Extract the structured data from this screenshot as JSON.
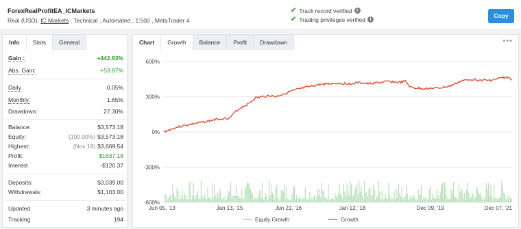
{
  "header": {
    "account_name": "ForexRealProfitEA_ICMarkets",
    "meta_prefix": "Real (USD), ",
    "broker": "IC Markets",
    "meta_suffix": " , Technical , Automated , 1:500 , MetaTrader 4",
    "track_record": "Track record verified",
    "trading_privileges": "Trading privileges verified",
    "copy_label": "Copy"
  },
  "left_tabs": [
    "Info",
    "Stats",
    "General"
  ],
  "stats": {
    "gain_label": "Gain :",
    "gain_value": "+442.93%",
    "abs_gain_label": "Abs. Gain:",
    "abs_gain_value": "+53.87%",
    "daily_label": "Daily",
    "daily_value": "0.05%",
    "monthly_label": "Monthly:",
    "monthly_value": "1.65%",
    "drawdown_label": "Drawdown:",
    "drawdown_value": "27.30%",
    "balance_label": "Balance:",
    "balance_value": "$3,573.18",
    "equity_label": "Equity:",
    "equity_note": "(100.00%)",
    "equity_value": "$3,573.18",
    "highest_label": "Highest:",
    "highest_note": "(Nov 19)",
    "highest_value": "$3,669.54",
    "profit_label": "Profit:",
    "profit_value": "$1637.18",
    "interest_label": "Interest",
    "interest_value": "-$120.37",
    "deposits_label": "Deposits:",
    "deposits_value": "$3,039.00",
    "withdrawals_label": "Withdrawals:",
    "withdrawals_value": "$1,103.00",
    "updated_label": "Updated",
    "updated_value": "3 minutes ago",
    "tracking_label": "Tracking",
    "tracking_value": "194"
  },
  "chart_tabs": [
    "Chart",
    "Growth",
    "Balance",
    "Profit",
    "Drawdown"
  ],
  "colors": {
    "growth": "#e8472a",
    "equity_growth": "#f5b942",
    "bars": "#9fd69f",
    "accent": "#2d8fdc"
  },
  "chart_data": {
    "type": "line",
    "x_tick_labels": [
      "Jun 05, '13",
      "Jan 13, '15",
      "Jun 21, '16",
      "Jan 12, '18",
      "Dec 09, '19",
      "Dec 07, '21"
    ],
    "x_tick_dates": [
      "2013-06-05",
      "2015-01-13",
      "2016-06-21",
      "2018-01-12",
      "2019-12-09",
      "2021-12-07"
    ],
    "y_ticks": [
      600,
      300,
      0,
      -300,
      -600
    ],
    "y_tick_labels": [
      "600%",
      "300%",
      "0%",
      "-300%",
      "-600%"
    ],
    "ylim": [
      -600,
      600
    ],
    "grid": true,
    "legend": [
      "Equity Growth",
      "Growth"
    ],
    "legend_position": "bottom",
    "series": [
      {
        "name": "Growth",
        "x": [
          "2013-06-05",
          "2013-08-01",
          "2013-10-01",
          "2014-01-01",
          "2014-04-01",
          "2014-07-01",
          "2014-10-01",
          "2015-01-13",
          "2015-03-15",
          "2015-05-01",
          "2015-07-01",
          "2015-09-01",
          "2015-11-01",
          "2016-01-01",
          "2016-03-01",
          "2016-06-21",
          "2016-09-01",
          "2016-12-01",
          "2017-03-01",
          "2017-06-01",
          "2017-09-01",
          "2018-01-12",
          "2018-03-01",
          "2018-06-01",
          "2018-09-01",
          "2018-12-01",
          "2019-03-01",
          "2019-05-01",
          "2019-06-15",
          "2019-09-01",
          "2019-12-09",
          "2020-03-01",
          "2020-06-01",
          "2020-09-01",
          "2020-12-01",
          "2021-03-01",
          "2021-06-01",
          "2021-09-01",
          "2021-11-01",
          "2021-12-07"
        ],
        "y": [
          0,
          20,
          40,
          60,
          75,
          90,
          110,
          120,
          180,
          210,
          240,
          290,
          300,
          310,
          300,
          340,
          360,
          380,
          400,
          410,
          415,
          410,
          420,
          410,
          420,
          430,
          420,
          430,
          380,
          370,
          370,
          375,
          390,
          430,
          450,
          440,
          440,
          460,
          465,
          443
        ]
      },
      {
        "name": "Equity Growth",
        "x": [
          "2013-06-05",
          "2021-12-07"
        ],
        "y": [
          0,
          443
        ]
      }
    ]
  }
}
